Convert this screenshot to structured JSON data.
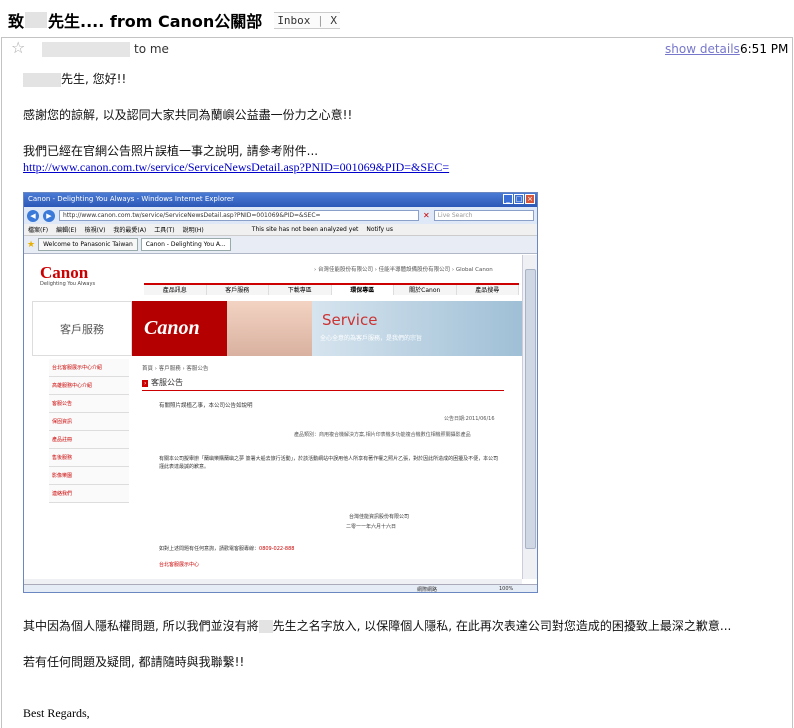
{
  "email": {
    "subject_prefix": "致",
    "subject_suffix": "先生.... from Canon公關部",
    "label": "Inbox",
    "label_close": "X",
    "to": "to me",
    "show_details": "show details",
    "time": "6:51 PM",
    "greeting": "先生, 您好!!",
    "line1": "感謝您的諒解, 以及認同大家共同為蘭嶼公益盡一份力之心意!!",
    "line2": "我們已經在官網公告照片誤植一事之說明, 請參考附件...",
    "link": "http://www.canon.com.tw/service/ServiceNewsDetail.asp?PNID=001069&PID=&SEC=",
    "line3_a": "其中因為個人隱私權問題, 所以我們並沒有將",
    "line3_b": "先生之名字放入, 以保障個人隱私, 在此再次表達公司對您造成的困擾致上最深之歉意...",
    "line4": "若有任何問題及疑問, 都請隨時與我聯繫!!",
    "signoff": "Best Regards,"
  },
  "screenshot": {
    "window_title": "Canon - Delighting You Always - Windows Internet Explorer",
    "address": "http://www.canon.com.tw/service/ServiceNewsDetail.asp?PNID=001069&PID=&SEC=",
    "search_placeholder": "Live Search",
    "menu": [
      "檔案(F)",
      "編輯(E)",
      "檢視(V)",
      "我的最愛(A)",
      "工具(T)",
      "說明(H)"
    ],
    "phish_status": "This site has not been analyzed yet",
    "notify": "Notify us",
    "tabs": [
      "Welcome to Panasonic Taiwan",
      "Canon - Delighting You A..."
    ],
    "logo": "Canon",
    "tagline": "Delighting You Always",
    "top_links": "› 台灣佳能股份有限公司  › 佳能半導體設備股份有限公司  › Global Canon",
    "nav": [
      "產品訊息",
      "客戶服務",
      "下載專區",
      "環保專區",
      "關於Canon",
      "產品搜尋"
    ],
    "service_title": "客戶服務",
    "banner_logo": "Canon",
    "banner_service": "Service",
    "banner_sub": "全心全意的為客戶服務，是我們的宗旨",
    "left_nav": [
      "台北客服展示中心介紹",
      "高雄服務中心介紹",
      "客服公告",
      "保固資訊",
      "產品註冊",
      "售後服務",
      "影像樂園",
      "連絡我們"
    ],
    "breadcrumb": "首頁 › 客戶服務 › 客服公告",
    "announce_title": "客服公告",
    "notice_title": "有關照片誤植乙事，本公司公告如說明",
    "notice_date": "公告日期:2011/06/16",
    "notice_cat": "產品類別：商用複合機解決方案,相片印表機多功能複合機數位相機照關攝影產品",
    "notice_body": "有關本公司擬舉辦「蘭嶼樂購蘭嶼之夢 簽署大船去旅行活動」，於該活動網站中誤用他人所享有著作權之照片乙張，對於因此所造成的困擾及不便，本公司謹此表達最誠的歉意。",
    "notice_company": "台灣佳能資訊股份有限公司",
    "notice_dt": "二零一一年六月十六日",
    "contact_text": "如對上述問題有任何意詢，請歡電客服專線：",
    "contact_phone": "0809-022-888",
    "foot_link": "台北客服展示中心",
    "status_zone": "網際網路",
    "status_zoom": "100%"
  }
}
